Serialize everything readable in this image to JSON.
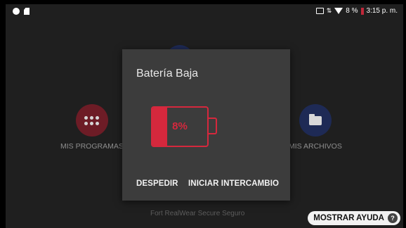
{
  "status_bar": {
    "battery_percent": "8 %",
    "time": "3:15 p. m.",
    "colors": {
      "battery_low": "#c0283a"
    }
  },
  "apps": {
    "programs_label": "MIS PROGRAMAS",
    "files_label": "MIS ARCHIVOS"
  },
  "footer": {
    "device_text": "Fort RealWear Secure Seguro",
    "help_label": "MOSTRAR AYUDA",
    "help_icon_glyph": "?"
  },
  "dialog": {
    "title": "Batería Baja",
    "battery_level": 0.08,
    "battery_fill_ratio": 0.27,
    "battery_label": "8%",
    "dismiss_label": "DESPEDIR",
    "swap_label": "INICIAR INTERCAMBIO",
    "colors": {
      "battery": "#d5283d",
      "dialog_bg": "#3c3c3c"
    }
  }
}
